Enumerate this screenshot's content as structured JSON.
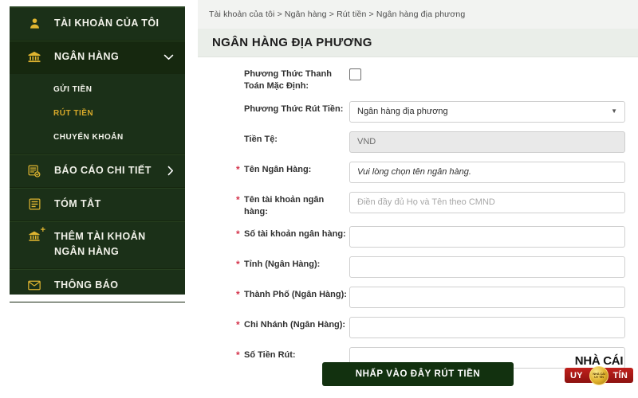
{
  "sidebar": {
    "items": [
      {
        "id": "my-account",
        "label": "TÀI KHOẢN CỦA TÔI",
        "icon": "user-icon",
        "caret": ""
      },
      {
        "id": "bank",
        "label": "NGÂN HÀNG",
        "icon": "bank-icon",
        "caret": "chevron-down-icon"
      },
      {
        "id": "detailed-report",
        "label": "BÁO CÁO CHI TIẾT",
        "icon": "report-icon",
        "caret": "chevron-right-icon"
      },
      {
        "id": "summary",
        "label": "TÓM TẮT",
        "icon": "summary-icon",
        "caret": ""
      },
      {
        "id": "add-bank-account",
        "label": "THÊM TÀI KHOẢN NGÂN HÀNG",
        "icon": "bank-plus-icon",
        "caret": ""
      },
      {
        "id": "notification",
        "label": "THÔNG BÁO",
        "icon": "envelope-icon",
        "caret": ""
      }
    ],
    "sub_items": [
      {
        "id": "deposit",
        "label": "GỬI TIỀN",
        "active": false
      },
      {
        "id": "withdraw",
        "label": "RÚT TIỀN",
        "active": true
      },
      {
        "id": "transfer",
        "label": "CHUYỂN KHOẢN",
        "active": false
      }
    ],
    "colors": {
      "background": "#1b3018",
      "active_background": "#16280f",
      "icon": "#e0b530",
      "active_text": "#d7a92a"
    }
  },
  "header": {
    "breadcrumb": "Tài khoản của tôi > Ngân hàng > Rút tiền > Ngân hàng địa phương",
    "title": "NGÂN HÀNG ĐỊA PHƯƠNG"
  },
  "form": {
    "rows": [
      {
        "id": "default-payment-method",
        "label": "Phương Thức Thanh Toán Mặc Định:",
        "required": false,
        "control": "checkbox",
        "checked": false
      },
      {
        "id": "withdraw-method",
        "label": "Phương Thức Rút Tiền:",
        "required": false,
        "control": "select",
        "value": "Ngân hàng địa phương",
        "arrow": "caret-down-icon"
      },
      {
        "id": "currency",
        "label": "Tiền Tệ:",
        "required": false,
        "control": "text-disabled",
        "value": "VND"
      },
      {
        "id": "bank-name",
        "label": "Tên Ngân Hàng:",
        "required": true,
        "control": "text-italic",
        "value": "Vui lòng chọn tên ngân hàng."
      },
      {
        "id": "bank-account-name",
        "label": "Tên tài khoản ngân hàng:",
        "required": true,
        "control": "text-placeholder",
        "value": "",
        "placeholder": "Điền đầy đủ Họ và Tên theo CMND"
      },
      {
        "id": "bank-account-number",
        "label": "Số tài khoản ngân hàng:",
        "required": true,
        "control": "text",
        "value": ""
      },
      {
        "id": "bank-province",
        "label": "Tỉnh (Ngân Hàng):",
        "required": true,
        "control": "text",
        "value": ""
      },
      {
        "id": "bank-city",
        "label": "Thành Phố (Ngân Hàng):",
        "required": true,
        "control": "text",
        "value": ""
      },
      {
        "id": "bank-branch",
        "label": "Chi Nhánh (Ngân Hàng):",
        "required": true,
        "control": "text",
        "value": ""
      },
      {
        "id": "withdraw-amount",
        "label": "Số Tiền Rút:",
        "required": true,
        "control": "text",
        "value": ""
      }
    ],
    "required_marker": "*",
    "submit_label": "NHẤP VÀO ĐÂY RÚT TIỀN"
  },
  "watermark": {
    "top_text": "NHÀ CÁI",
    "left_word": "UY",
    "right_word": "TÍN",
    "seal_line1": "NHÀ CÁI",
    "seal_line2": "UY TÍN",
    "colors": {
      "bar": "#c0201c",
      "seal": "#e0b02a"
    }
  }
}
